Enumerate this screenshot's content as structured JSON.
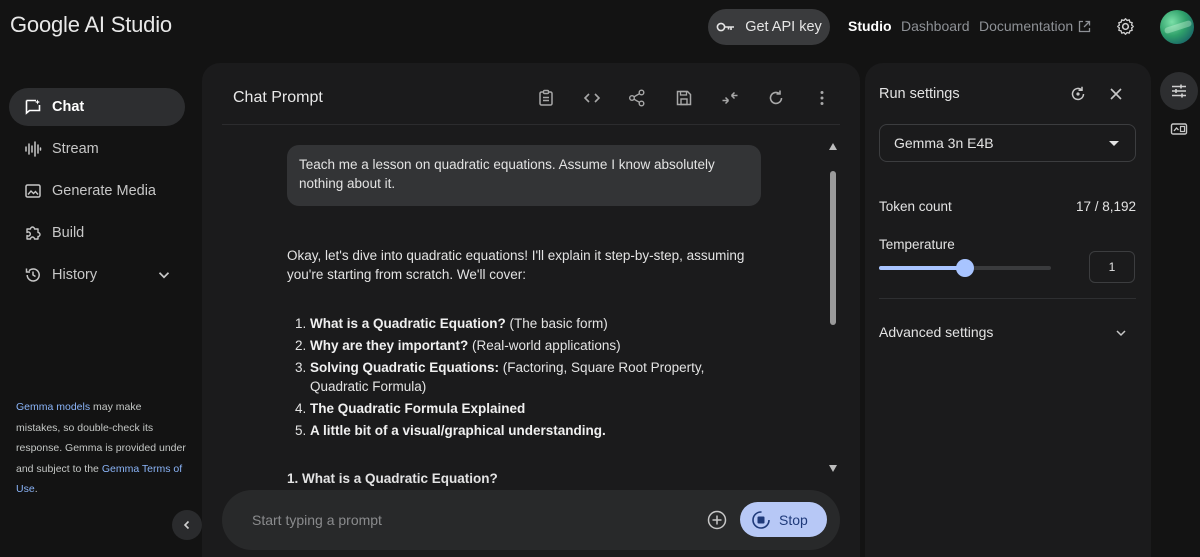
{
  "header": {
    "logo": "Google AI Studio",
    "api_key_label": "Get API key",
    "nav": {
      "studio": "Studio",
      "dashboard": "Dashboard",
      "documentation": "Documentation"
    }
  },
  "sidebar": {
    "items": [
      {
        "label": "Chat",
        "icon": "chat-icon",
        "active": true
      },
      {
        "label": "Stream",
        "icon": "waveform-icon"
      },
      {
        "label": "Generate Media",
        "icon": "media-icon"
      },
      {
        "label": "Build",
        "icon": "build-icon"
      },
      {
        "label": "History",
        "icon": "history-icon"
      }
    ],
    "disclaimer": {
      "link1": "Gemma models",
      "text1": " may make mistakes, so double-check its response. Gemma is provided under and subject to the ",
      "link2": "Gemma Terms of Use",
      "text2": "."
    }
  },
  "chat": {
    "title": "Chat Prompt",
    "toolbar_icons": [
      "clipboard-icon",
      "code-icon",
      "share-icon",
      "save-icon",
      "compare-icon",
      "refresh-icon",
      "more-icon"
    ],
    "user_message": "Teach me a lesson on quadratic equations. Assume I know absolutely nothing about it.",
    "reply_intro": "Okay, let's dive into quadratic equations! I'll explain it step-by-step, assuming you're starting from scratch. We'll cover:",
    "reply_list": [
      {
        "num": "1.",
        "bold": "What is a Quadratic Equation?",
        "rest": " (The basic form)"
      },
      {
        "num": "2.",
        "bold": "Why are they important?",
        "rest": " (Real-world applications)"
      },
      {
        "num": "3.",
        "bold": "Solving Quadratic Equations:",
        "rest": " (Factoring, Square Root Property, Quadratic Formula)"
      },
      {
        "num": "4.",
        "bold": "The Quadratic Formula Explained",
        "rest": ""
      },
      {
        "num": "5.",
        "bold": "A little bit of a visual/graphical understanding.",
        "rest": ""
      }
    ],
    "section_heading": "1. What is a Quadratic Equation?",
    "prompt_placeholder": "Start typing a prompt",
    "prompt_value": "",
    "stop_label": "Stop"
  },
  "settings": {
    "title": "Run settings",
    "model": "Gemma 3n E4B",
    "token_count_label": "Token count",
    "token_count_value": "17 / 8,192",
    "temperature_label": "Temperature",
    "temperature_value": "1",
    "temperature_fraction": 0.5,
    "advanced_label": "Advanced settings"
  },
  "colors": {
    "accent": "#a8c4ff",
    "stop_button": "#b7c8f6",
    "link": "#8ab4f8",
    "panel_bg": "#1b1b1c",
    "page_bg": "#131313"
  }
}
